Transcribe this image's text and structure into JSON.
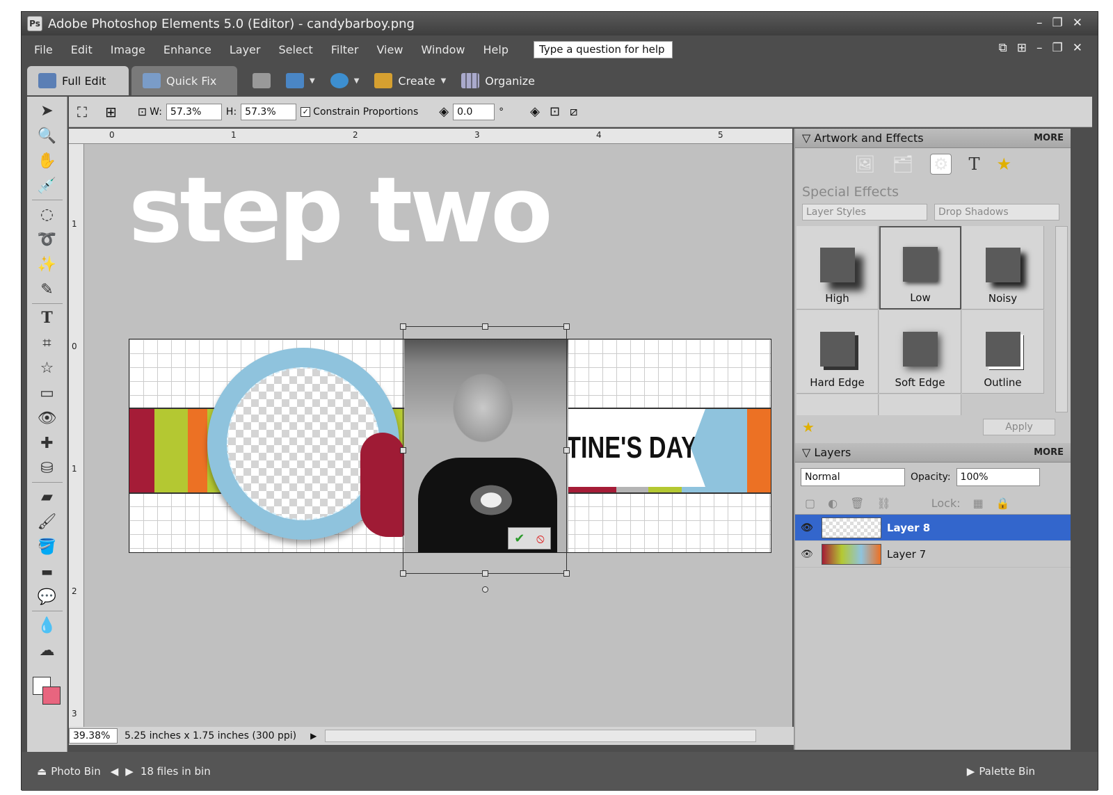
{
  "window": {
    "title": "Adobe Photoshop Elements 5.0 (Editor) - candybarboy.png"
  },
  "menu": [
    "File",
    "Edit",
    "Image",
    "Enhance",
    "Layer",
    "Select",
    "Filter",
    "View",
    "Window",
    "Help"
  ],
  "help_box": "Type a question for help",
  "modes": {
    "full_edit": "Full Edit",
    "quick_fix": "Quick Fix",
    "create": "Create",
    "organize": "Organize"
  },
  "options": {
    "w_label": "W:",
    "w_value": "57.3%",
    "h_label": "H:",
    "h_value": "57.3%",
    "constrain": "Constrain Proportions",
    "rotate_value": "0.0",
    "degree": "°"
  },
  "canvas": {
    "headline": "step two",
    "banner_text": "TINE'S DAY"
  },
  "ruler": {
    "top": [
      "0",
      "1",
      "2",
      "3",
      "4",
      "5"
    ],
    "left": [
      "1",
      "0",
      "1",
      "2",
      "3"
    ]
  },
  "status": {
    "zoom": "39.38%",
    "dimensions": "5.25 inches x 1.75 inches (300 ppi)"
  },
  "bottom": {
    "photo_bin": "Photo Bin",
    "files": "18 files in bin",
    "palette_bin": "Palette Bin"
  },
  "artwork": {
    "title": "Artwork and Effects",
    "more": "MORE",
    "section": "Special Effects",
    "dropdown1": "Layer Styles",
    "dropdown2": "Drop Shadows",
    "effects": [
      "High",
      "Low",
      "Noisy",
      "Hard Edge",
      "Soft Edge",
      "Outline"
    ],
    "apply": "Apply"
  },
  "layers": {
    "title": "Layers",
    "more": "MORE",
    "blend_mode": "Normal",
    "opacity_label": "Opacity:",
    "opacity_value": "100%",
    "lock_label": "Lock:",
    "rows": [
      "Layer 8",
      "Layer 7"
    ]
  },
  "colors": {
    "accent": "#3366cc",
    "stripe_red": "#a51c37",
    "stripe_green": "#b4c832",
    "stripe_orange": "#ec7124",
    "stripe_blue": "#8fc3dd",
    "stripe_gray": "#b4b4b4",
    "frame_blue": "#8fc3dd",
    "heart": "#9f1b35"
  }
}
